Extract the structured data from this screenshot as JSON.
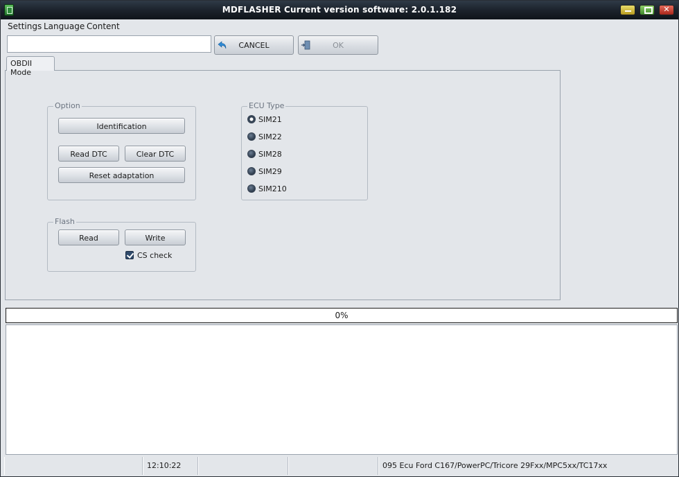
{
  "window": {
    "title": "MDFLASHER  Current version software: 2.0.1.182",
    "icon": "app-icon"
  },
  "menu": {
    "items": [
      "Settings",
      "Language",
      "Content"
    ]
  },
  "toolbar": {
    "input_value": "",
    "cancel_label": "CANCEL",
    "ok_label": "OK"
  },
  "tabs": [
    {
      "label": "OBDII Mode",
      "active": true
    }
  ],
  "option_group": {
    "legend": "Option",
    "identification": "Identification",
    "read_dtc": "Read DTC",
    "clear_dtc": "Clear DTC",
    "reset_adaptation": "Reset adaptation"
  },
  "flash_group": {
    "legend": "Flash",
    "read": "Read",
    "write": "Write",
    "cs_check": "CS check",
    "cs_check_checked": true
  },
  "ecu_group": {
    "legend": "ECU Type",
    "options": [
      "SIM21",
      "SIM22",
      "SIM28",
      "SIM29",
      "SIM210"
    ],
    "selected": "SIM21"
  },
  "progress": {
    "label": "0%",
    "value": 0
  },
  "statusbar": {
    "cells": [
      "",
      "12:10:22",
      "",
      "",
      "095 Ecu Ford C167/PowerPC/Tricore 29Fxx/MPC5xx/TC17xx"
    ]
  }
}
